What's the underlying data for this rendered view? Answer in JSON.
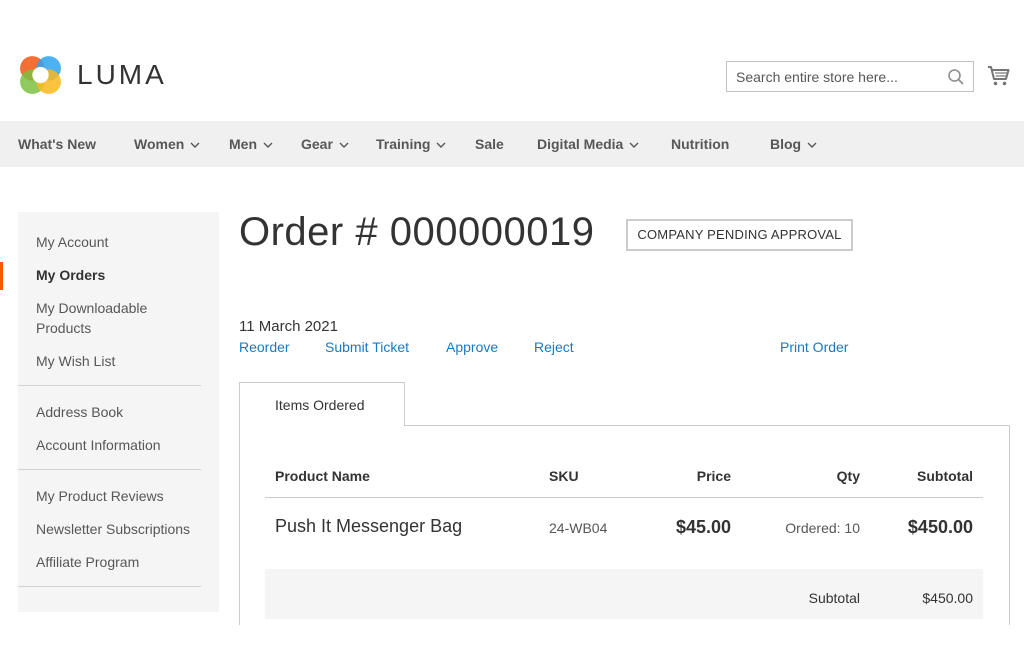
{
  "brand": {
    "name": "LUMA"
  },
  "search": {
    "placeholder": "Search entire store here..."
  },
  "icons": {
    "search": "search-icon",
    "cart": "cart-icon",
    "chevron": "chevron-down-icon"
  },
  "colors": {
    "accent": "#ff5501",
    "link": "#1979c3",
    "nav_bg": "#f0f0f0",
    "sidebar_bg": "#f5f5f5"
  },
  "nav": {
    "items": [
      {
        "label": "What's New",
        "has_dropdown": false
      },
      {
        "label": "Women",
        "has_dropdown": true
      },
      {
        "label": "Men",
        "has_dropdown": true
      },
      {
        "label": "Gear",
        "has_dropdown": true
      },
      {
        "label": "Training",
        "has_dropdown": true
      },
      {
        "label": "Sale",
        "has_dropdown": false
      },
      {
        "label": "Digital Media",
        "has_dropdown": true
      },
      {
        "label": "Nutrition",
        "has_dropdown": false
      },
      {
        "label": "Blog",
        "has_dropdown": true
      }
    ]
  },
  "sidebar": {
    "items": [
      {
        "label": "My Account"
      },
      {
        "label": "My Orders",
        "active": true
      },
      {
        "label": "My Downloadable Products"
      },
      {
        "label": "My Wish List"
      },
      {
        "label": "Address Book"
      },
      {
        "label": "Account Information"
      },
      {
        "label": "My Product Reviews"
      },
      {
        "label": "Newsletter Subscriptions"
      },
      {
        "label": "Affiliate Program"
      }
    ]
  },
  "order": {
    "title": "Order # 000000019",
    "status": "COMPANY PENDING APPROVAL",
    "date": "11 March 2021",
    "actions": {
      "reorder": "Reorder",
      "submit_ticket": "Submit Ticket",
      "approve": "Approve",
      "reject": "Reject",
      "print": "Print Order"
    },
    "tab": "Items Ordered",
    "columns": {
      "product": "Product Name",
      "sku": "SKU",
      "price": "Price",
      "qty": "Qty",
      "subtotal": "Subtotal"
    },
    "items": [
      {
        "name": "Push It Messenger Bag",
        "sku": "24-WB04",
        "price": "$45.00",
        "qty": "Ordered: 10",
        "subtotal": "$450.00"
      }
    ],
    "totals": {
      "subtotal_label": "Subtotal",
      "subtotal_value": "$450.00"
    }
  }
}
